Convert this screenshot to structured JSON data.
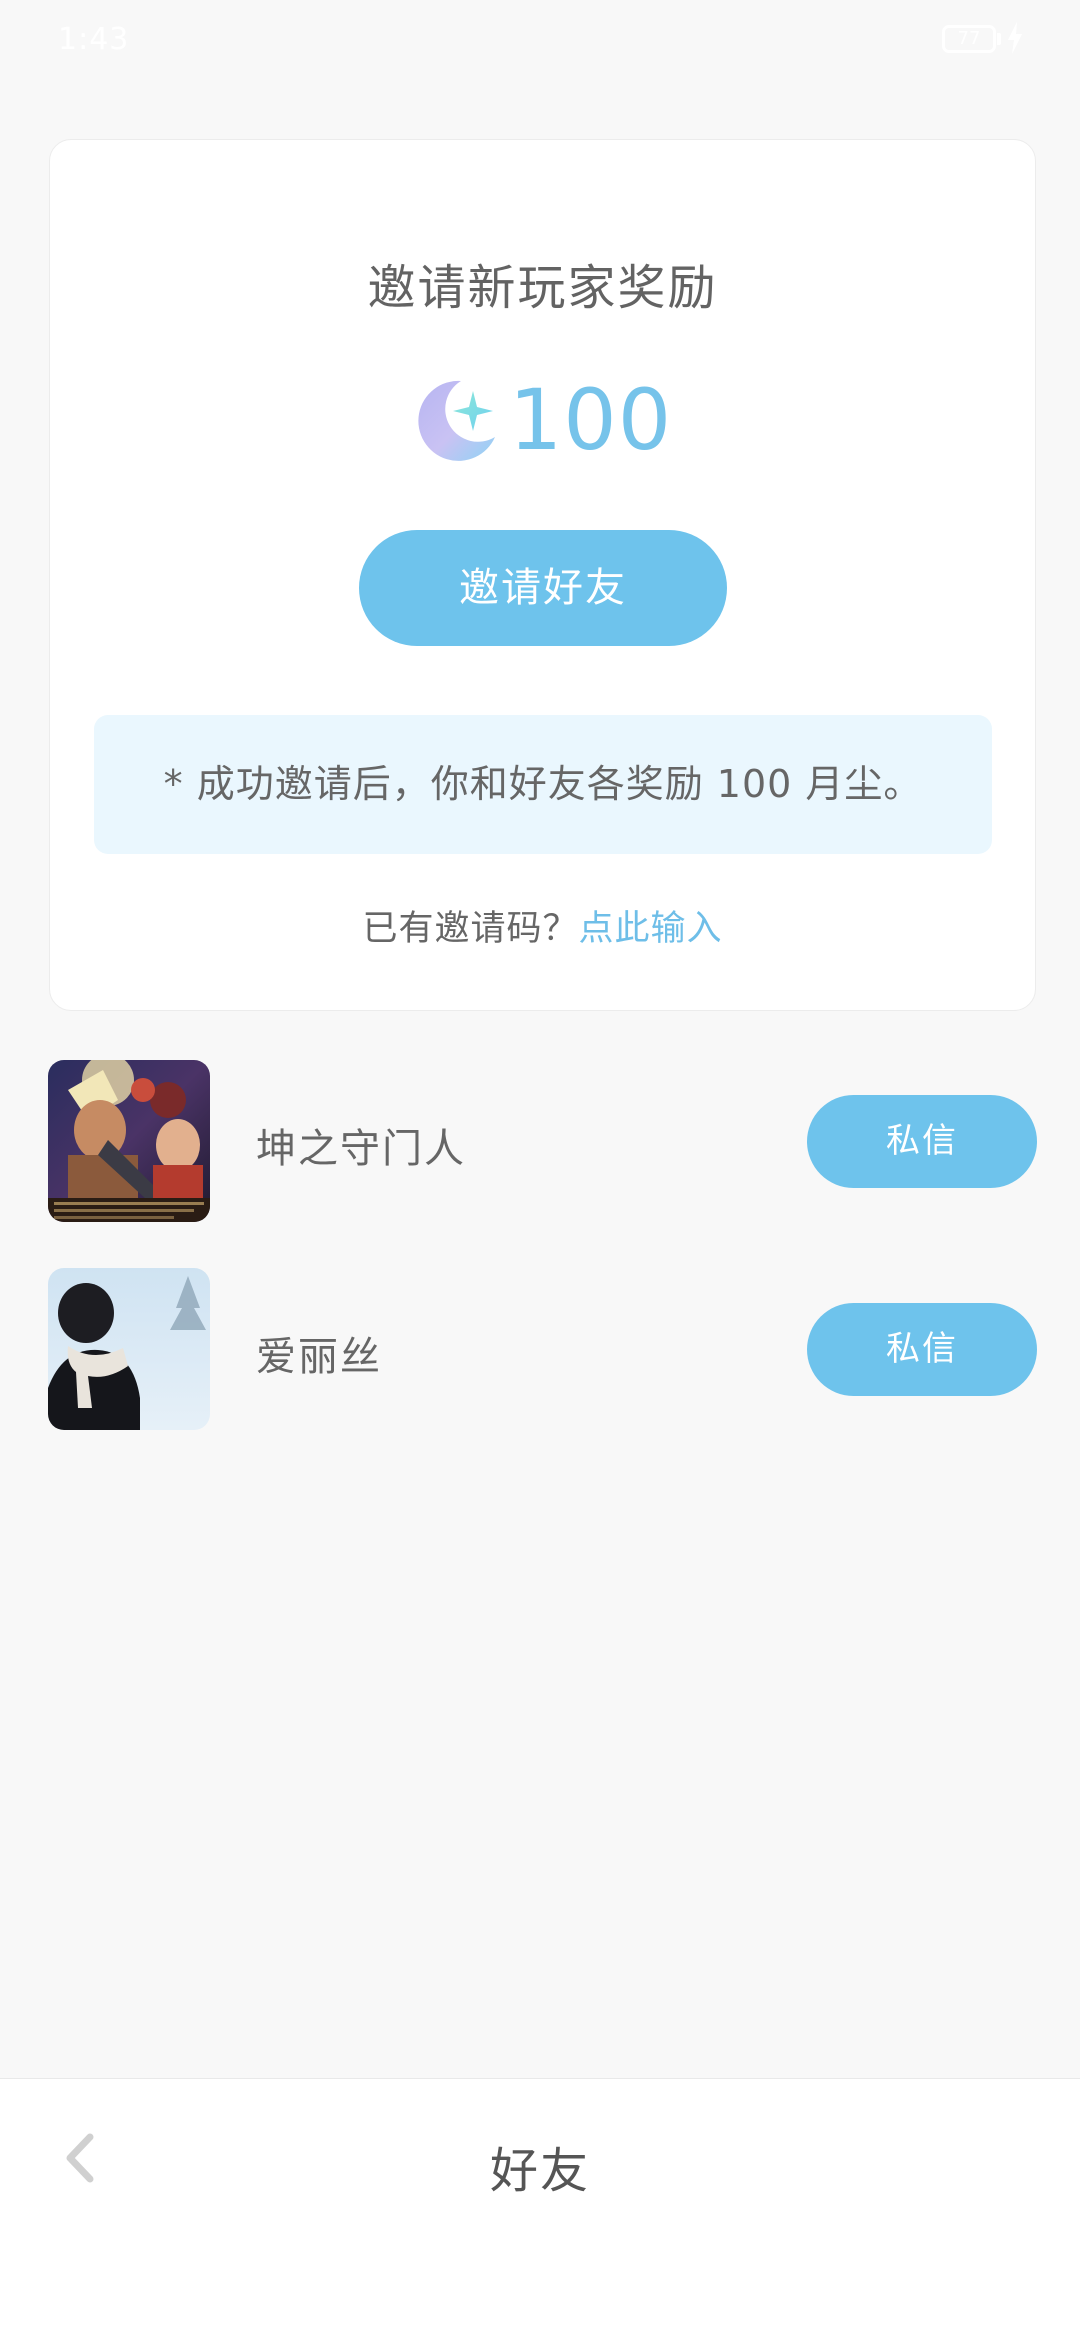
{
  "status_bar": {
    "time": "1:43",
    "battery": "77",
    "colors": {
      "text": "#ffffff"
    }
  },
  "invite_card": {
    "title": "邀请新玩家奖励",
    "reward_icon": "moon-star-icon",
    "reward_amount": "100",
    "invite_button": "邀请好友",
    "notice": "* 成功邀请后，你和好友各奖励 100 月尘。",
    "code_prompt": "已有邀请码？",
    "code_link": "点此输入"
  },
  "friends": [
    {
      "name": "坤之守门人",
      "avatar": "game-artwork-avatar",
      "action": "私信"
    },
    {
      "name": "爱丽丝",
      "avatar": "snowy-portrait-avatar",
      "action": "私信"
    }
  ],
  "bottom_bar": {
    "back_icon": "chevron-left-icon",
    "title": "好友"
  },
  "colors": {
    "accent": "#6ec3ec",
    "accent_text": "#76c3ea",
    "notice_bg": "#eaf7fe",
    "page_bg": "#f8f8f8"
  }
}
